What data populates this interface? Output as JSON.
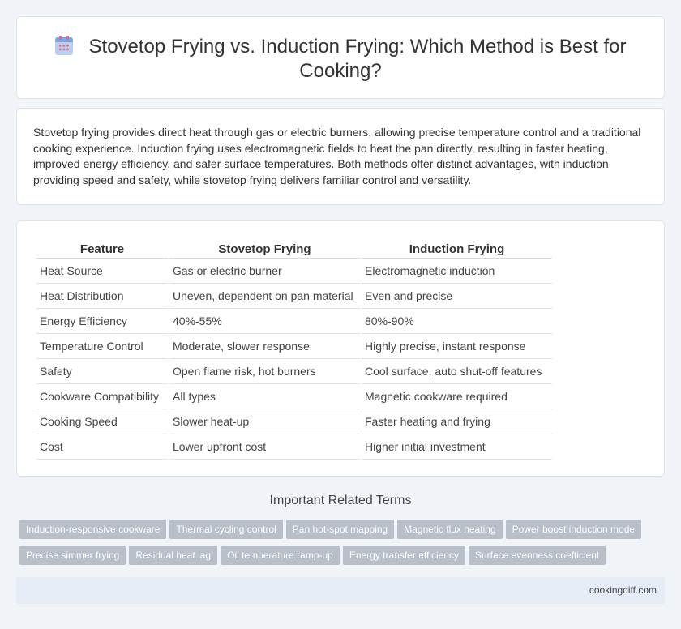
{
  "header": {
    "title": "Stovetop Frying vs. Induction Frying: Which Method is Best for Cooking?",
    "icon": "calendar-icon"
  },
  "summary": "Stovetop frying provides direct heat through gas or electric burners, allowing precise temperature control and a traditional cooking experience. Induction frying uses electromagnetic fields to heat the pan directly, resulting in faster heating, improved energy efficiency, and safer surface temperatures. Both methods offer distinct advantages, with induction providing speed and safety, while stovetop frying delivers familiar control and versatility.",
  "table": {
    "headers": [
      "Feature",
      "Stovetop Frying",
      "Induction Frying"
    ],
    "rows": [
      [
        "Heat Source",
        "Gas or electric burner",
        "Electromagnetic induction"
      ],
      [
        "Heat Distribution",
        "Uneven, dependent on pan material",
        "Even and precise"
      ],
      [
        "Energy Efficiency",
        "40%-55%",
        "80%-90%"
      ],
      [
        "Temperature Control",
        "Moderate, slower response",
        "Highly precise, instant response"
      ],
      [
        "Safety",
        "Open flame risk, hot burners",
        "Cool surface, auto shut-off features"
      ],
      [
        "Cookware Compatibility",
        "All types",
        "Magnetic cookware required"
      ],
      [
        "Cooking Speed",
        "Slower heat-up",
        "Faster heating and frying"
      ],
      [
        "Cost",
        "Lower upfront cost",
        "Higher initial investment"
      ]
    ]
  },
  "related": {
    "title": "Important Related Terms",
    "tags": [
      "Induction-responsive cookware",
      "Thermal cycling control",
      "Pan hot-spot mapping",
      "Magnetic flux heating",
      "Power boost induction mode",
      "Precise simmer frying",
      "Residual heat lag",
      "Oil temperature ramp-up",
      "Energy transfer efficiency",
      "Surface evenness coefficient"
    ]
  },
  "footer": {
    "site": "cookingdiff.com"
  }
}
